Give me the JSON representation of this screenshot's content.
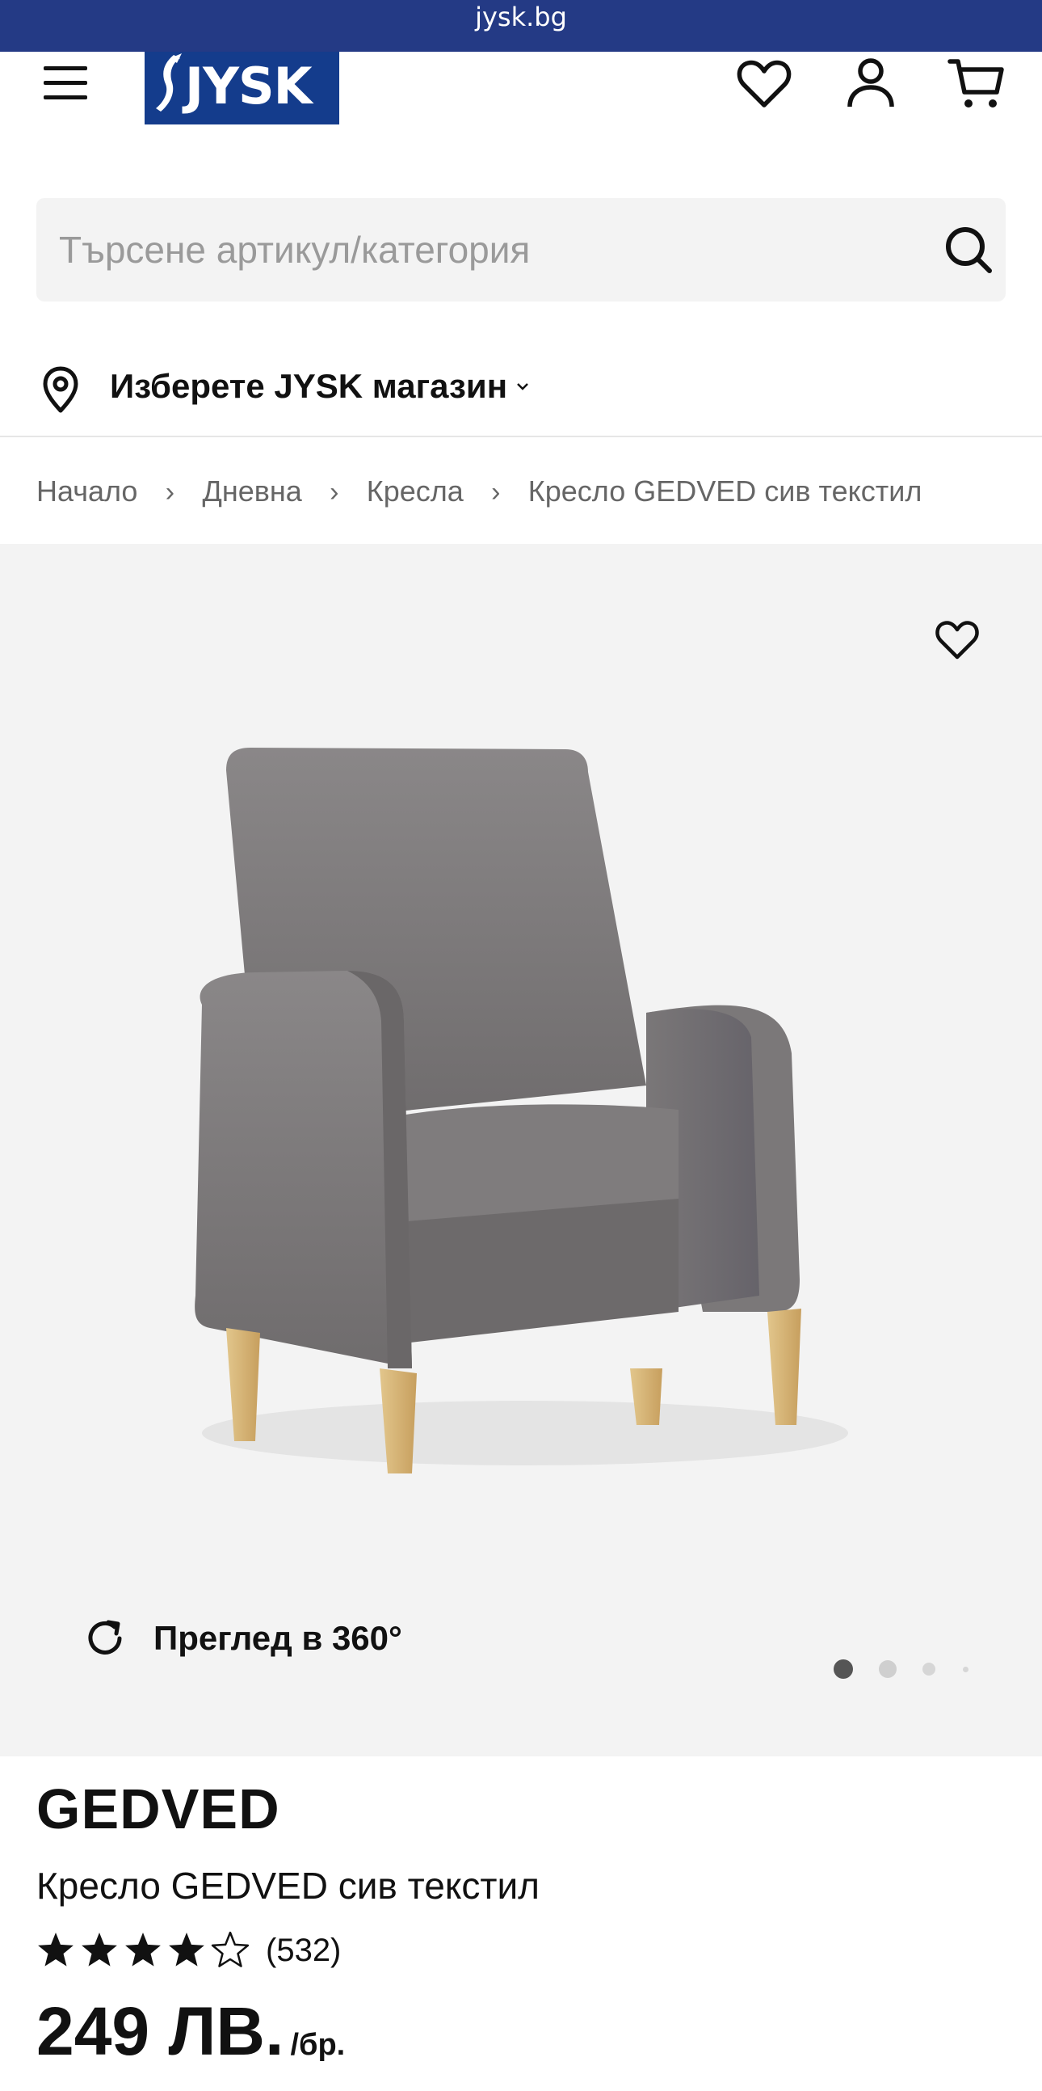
{
  "browser": {
    "url": "jysk.bg"
  },
  "brand": {
    "logo_text": "JYSK",
    "color": "#143c8c",
    "urlbar_color": "#243a85"
  },
  "header": {
    "icons": [
      "menu-icon",
      "heart-icon",
      "user-icon",
      "cart-icon"
    ]
  },
  "search": {
    "placeholder": "Търсене артикул/категория",
    "value": ""
  },
  "store_selector": {
    "label": "Изберете JYSK магазин"
  },
  "breadcrumb": {
    "items": [
      "Начало",
      "Дневна",
      "Кресла"
    ],
    "current": "Кресло GEDVED сив текстил",
    "separator": "›"
  },
  "gallery": {
    "view360_label": "Преглед в 360°",
    "slides_count_visible": 4,
    "active_slide": 1
  },
  "product": {
    "brand_name": "GEDVED",
    "name": "Кресло GEDVED сив текстил",
    "rating": 4,
    "rating_max": 5,
    "review_count": "(532)",
    "price": "249 ЛВ.",
    "price_unit": "/бр."
  }
}
